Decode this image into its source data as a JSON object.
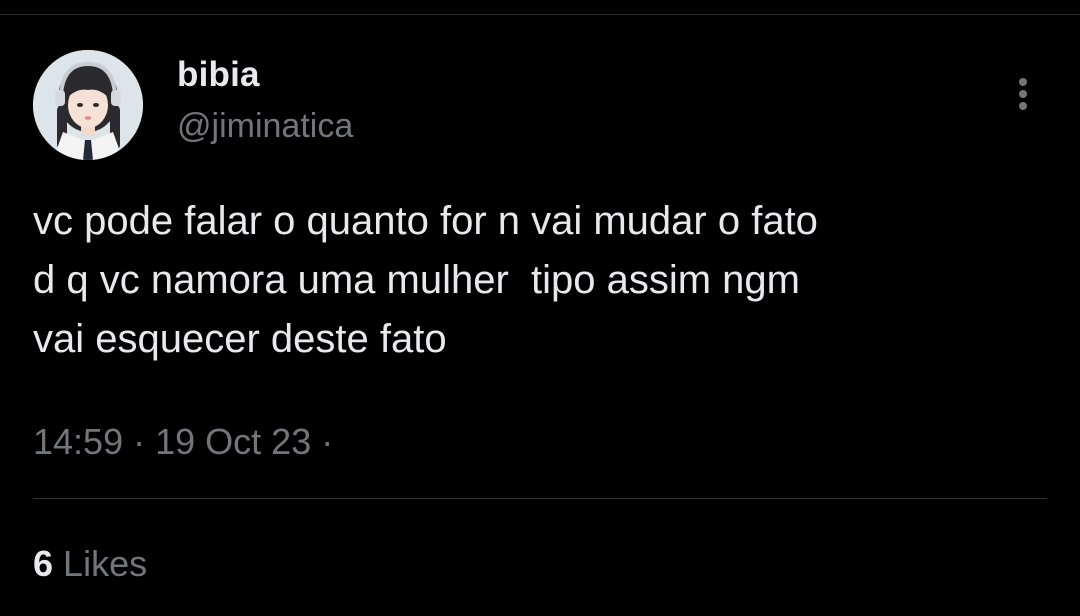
{
  "tweet": {
    "author": {
      "display_name": "bibia",
      "handle": "@jiminatica"
    },
    "text": "vc pode falar o quanto for n vai mudar o fato\nd q vc namora uma mulher  tipo assim ngm\nvai esquecer deste fato",
    "meta": {
      "time": "14:59",
      "separator": "·",
      "date": "19 Oct 23",
      "trailing": "·"
    },
    "engagement": {
      "likes_count": "6",
      "likes_label": "Likes"
    }
  },
  "icons": {
    "more": "more-vertical-icon"
  },
  "colors": {
    "background": "#000000",
    "primary_text": "#e7e9ea",
    "secondary_text": "#71767b",
    "divider": "#2f3336"
  }
}
